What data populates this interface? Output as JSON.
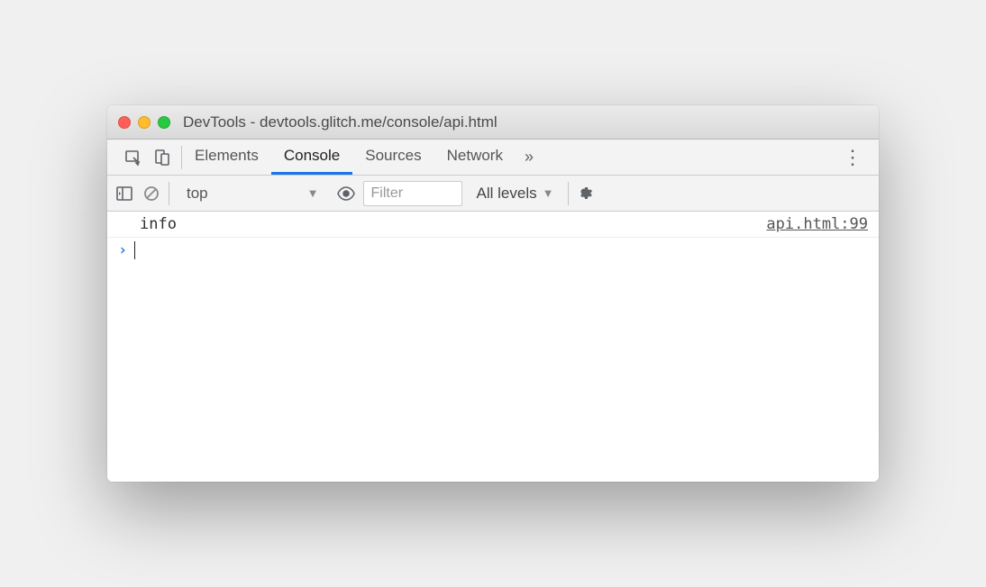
{
  "window": {
    "title": "DevTools - devtools.glitch.me/console/api.html"
  },
  "tabs": {
    "elements": "Elements",
    "console": "Console",
    "sources": "Sources",
    "network": "Network"
  },
  "filterbar": {
    "context": "top",
    "filter_placeholder": "Filter",
    "levels": "All levels"
  },
  "console": {
    "log_message": "info",
    "log_source": "api.html:99"
  }
}
